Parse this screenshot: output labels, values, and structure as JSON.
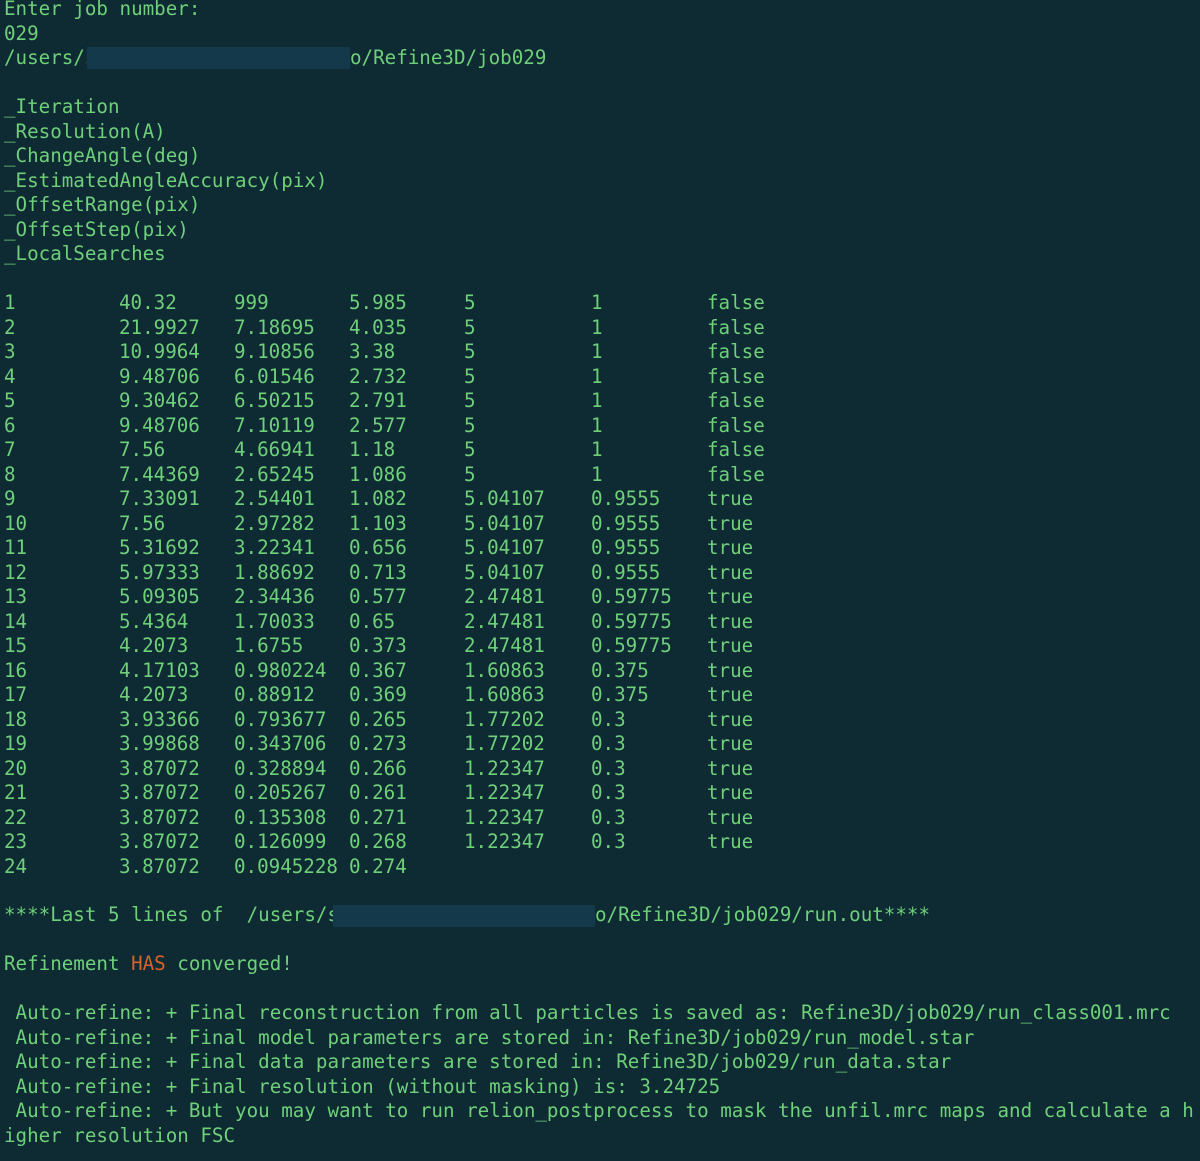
{
  "prompt_line": "Enter job number:",
  "job_input": "029",
  "path": {
    "prefix": "/users/s",
    "suffix": "o/Refine3D/job029"
  },
  "labels": [
    "_Iteration",
    "_Resolution(A)",
    "_ChangeAngle(deg)",
    "_EstimatedAngleAccuracy(pix)",
    "_OffsetRange(pix)",
    "_OffsetStep(pix)",
    "_LocalSearches"
  ],
  "rows": [
    [
      "1",
      "40.32",
      "999",
      "5.985",
      "5",
      "1",
      "false"
    ],
    [
      "2",
      "21.9927",
      "7.18695",
      "4.035",
      "5",
      "1",
      "false"
    ],
    [
      "3",
      "10.9964",
      "9.10856",
      "3.38",
      "5",
      "1",
      "false"
    ],
    [
      "4",
      "9.48706",
      "6.01546",
      "2.732",
      "5",
      "1",
      "false"
    ],
    [
      "5",
      "9.30462",
      "6.50215",
      "2.791",
      "5",
      "1",
      "false"
    ],
    [
      "6",
      "9.48706",
      "7.10119",
      "2.577",
      "5",
      "1",
      "false"
    ],
    [
      "7",
      "7.56",
      "4.66941",
      "1.18",
      "5",
      "1",
      "false"
    ],
    [
      "8",
      "7.44369",
      "2.65245",
      "1.086",
      "5",
      "1",
      "false"
    ],
    [
      "9",
      "7.33091",
      "2.54401",
      "1.082",
      "5.04107",
      "0.9555",
      "true"
    ],
    [
      "10",
      "7.56",
      "2.97282",
      "1.103",
      "5.04107",
      "0.9555",
      "true"
    ],
    [
      "11",
      "5.31692",
      "3.22341",
      "0.656",
      "5.04107",
      "0.9555",
      "true"
    ],
    [
      "12",
      "5.97333",
      "1.88692",
      "0.713",
      "5.04107",
      "0.9555",
      "true"
    ],
    [
      "13",
      "5.09305",
      "2.34436",
      "0.577",
      "2.47481",
      "0.59775",
      "true"
    ],
    [
      "14",
      "5.4364",
      "1.70033",
      "0.65",
      "2.47481",
      "0.59775",
      "true"
    ],
    [
      "15",
      "4.2073",
      "1.6755",
      "0.373",
      "2.47481",
      "0.59775",
      "true"
    ],
    [
      "16",
      "4.17103",
      "0.980224",
      "0.367",
      "1.60863",
      "0.375",
      "true"
    ],
    [
      "17",
      "4.2073",
      "0.88912",
      "0.369",
      "1.60863",
      "0.375",
      "true"
    ],
    [
      "18",
      "3.93366",
      "0.793677",
      "0.265",
      "1.77202",
      "0.3",
      "true"
    ],
    [
      "19",
      "3.99868",
      "0.343706",
      "0.273",
      "1.77202",
      "0.3",
      "true"
    ],
    [
      "20",
      "3.87072",
      "0.328894",
      "0.266",
      "1.22347",
      "0.3",
      "true"
    ],
    [
      "21",
      "3.87072",
      "0.205267",
      "0.261",
      "1.22347",
      "0.3",
      "true"
    ],
    [
      "22",
      "3.87072",
      "0.135308",
      "0.271",
      "1.22347",
      "0.3",
      "true"
    ],
    [
      "23",
      "3.87072",
      "0.126099",
      "0.268",
      "1.22347",
      "0.3",
      "true"
    ],
    [
      "24",
      "3.87072",
      "0.0945228",
      "0.274",
      "",
      "",
      ""
    ]
  ],
  "last_lines": {
    "prefix": "****Last 5 lines of  /users/s",
    "suffix": "o/Refine3D/job029/run.out****"
  },
  "converged": {
    "before": "Refinement ",
    "highlight": "HAS",
    "after": " converged!"
  },
  "output_lines": [
    " Auto-refine: + Final reconstruction from all particles is saved as: Refine3D/job029/run_class001.mrc",
    " Auto-refine: + Final model parameters are stored in: Refine3D/job029/run_model.star",
    " Auto-refine: + Final data parameters are stored in: Refine3D/job029/run_data.star",
    " Auto-refine: + Final resolution (without masking) is: 3.24725",
    " Auto-refine: + But you may want to run relion_postprocess to mask the unfil.mrc maps and calculate a h",
    "igher resolution FSC"
  ],
  "colors": {
    "background": "#0e2a33",
    "text": "#6fd07a",
    "highlight": "#d9622b",
    "redaction": "#14394a"
  }
}
